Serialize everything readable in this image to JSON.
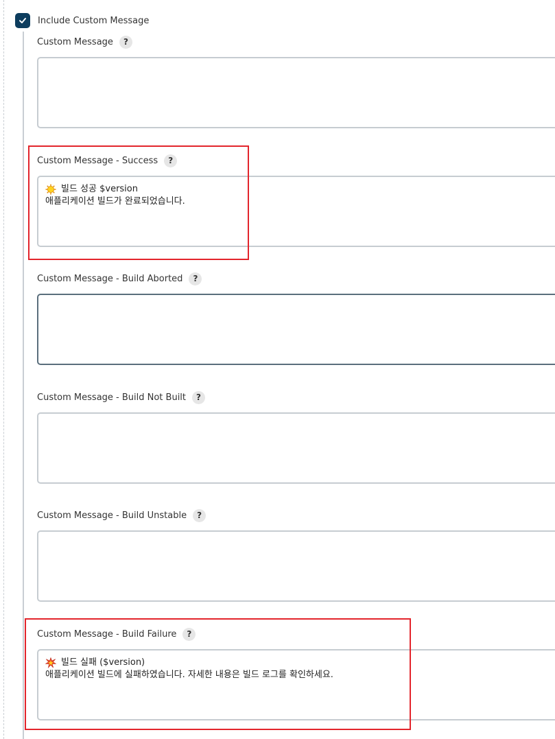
{
  "include_custom_message": {
    "checked": true,
    "label": "Include Custom Message"
  },
  "help_symbol": "?",
  "fields": {
    "custom_message": {
      "label": "Custom Message",
      "value": ""
    },
    "success": {
      "label": "Custom Message - Success",
      "icon": "sun-emoji-icon",
      "line1": "빌드 성공 $version",
      "line2": "애플리케이션 빌드가 완료되었습니다."
    },
    "build_aborted": {
      "label": "Custom Message - Build Aborted",
      "value": ""
    },
    "build_not_built": {
      "label": "Custom Message - Build Not Built",
      "value": ""
    },
    "build_unstable": {
      "label": "Custom Message - Build Unstable",
      "value": ""
    },
    "build_failure": {
      "label": "Custom Message - Build Failure",
      "icon": "collision-emoji-icon",
      "line1": "빌드 실패 ($version)",
      "line2": "애플리케이션 빌드에 실패하였습니다. 자세한 내용은 빌드 로그를 확인하세요."
    }
  },
  "colors": {
    "checkbox_fill": "#0d3d5e",
    "highlight_border": "#e3242b",
    "textarea_border": "#c6ccd1",
    "focused_border": "#5a6e7c",
    "help_badge": "#e6e6e6"
  }
}
